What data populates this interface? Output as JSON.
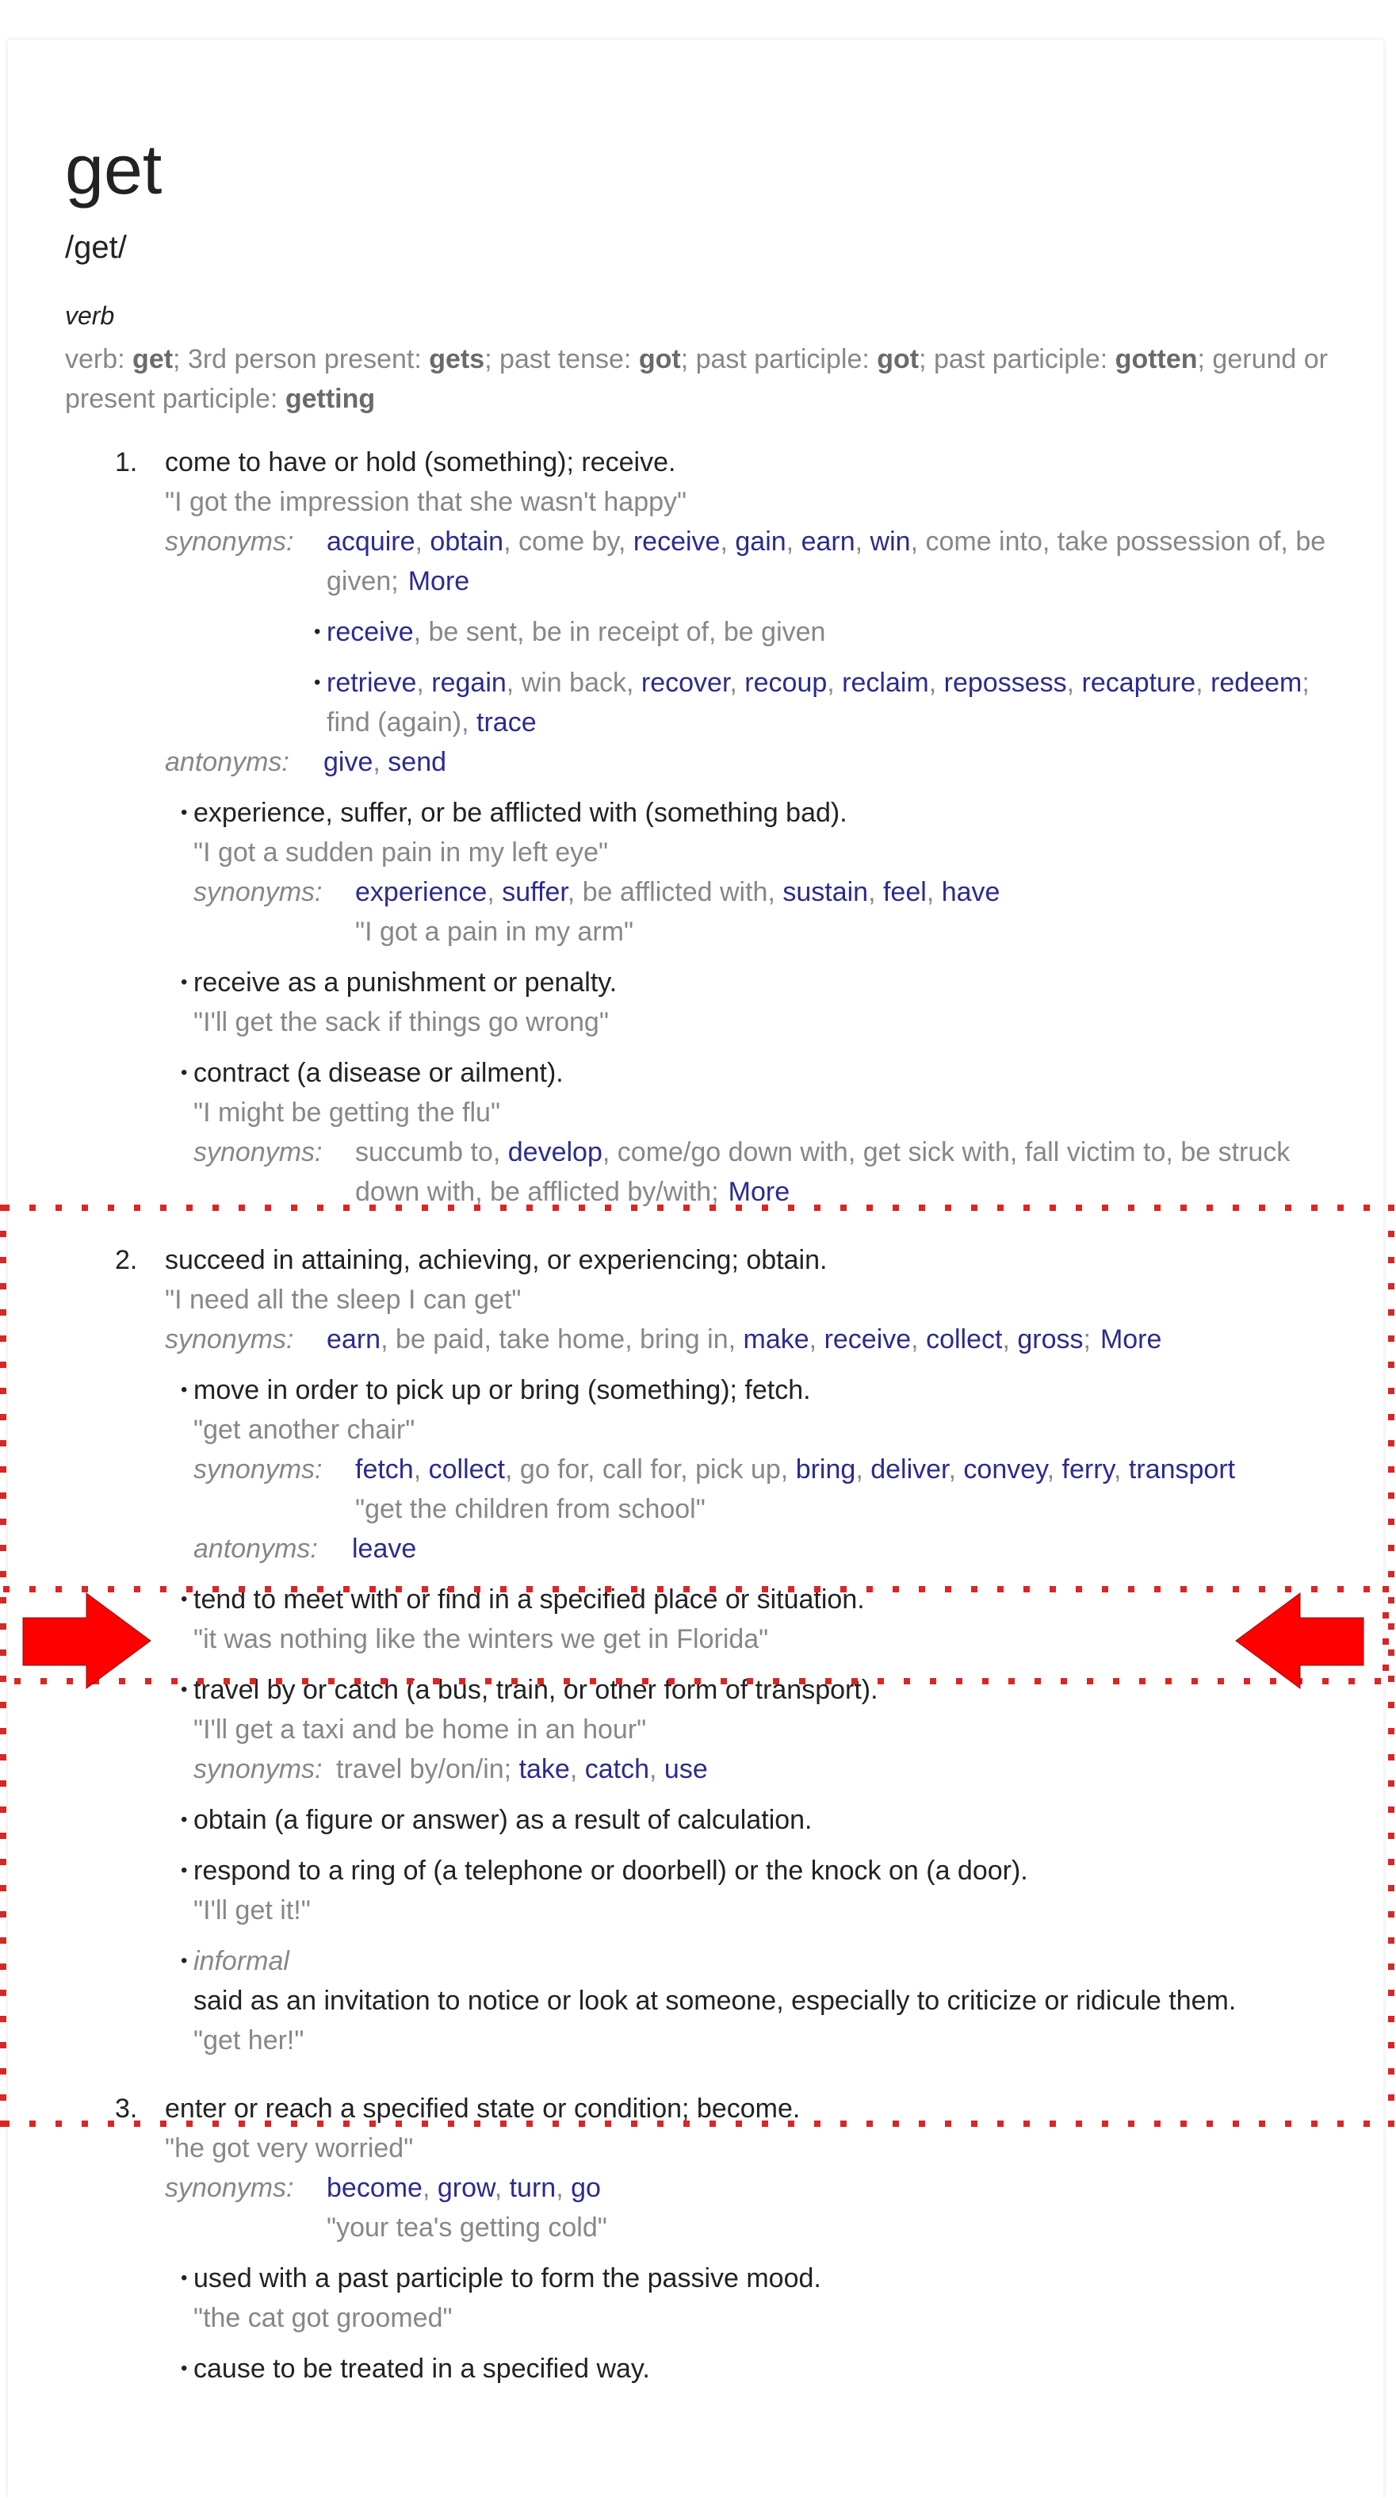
{
  "entry": {
    "headword": "get",
    "phonetic": "/get/",
    "part_of_speech": "verb",
    "forms": [
      {
        "label": "verb: ",
        "form": "get"
      },
      {
        "label": "; 3rd person present: ",
        "form": "gets"
      },
      {
        "label": "; past tense: ",
        "form": "got"
      },
      {
        "label": "; past participle: ",
        "form": "got"
      },
      {
        "label": "; past participle: ",
        "form": "gotten"
      },
      {
        "label": "; gerund or present participle: ",
        "form": "getting"
      }
    ]
  },
  "labels": {
    "synonyms": "synonyms:",
    "antonyms": "antonyms:",
    "more": "More"
  },
  "senses": {
    "s1": {
      "number": "1.",
      "gloss": "come to have or hold (something); receive.",
      "example": "\"I got the impression that she wasn't happy\"",
      "synonyms": [
        "acquire",
        "obtain",
        "come by",
        "receive",
        "gain",
        "earn",
        "win",
        "come into",
        "take possession of",
        "be given"
      ],
      "syn_groups": [
        [
          "receive",
          "be sent",
          "be in receipt of",
          "be given"
        ],
        [
          "retrieve",
          "regain",
          "win back",
          "recover",
          "recoup",
          "reclaim",
          "repossess",
          "recapture",
          "redeem"
        ]
      ],
      "syn_group2_extra": [
        "find (again)",
        "trace"
      ],
      "antonyms": [
        "give",
        "send"
      ],
      "subs": [
        {
          "gloss": "experience, suffer, or be afflicted with (something bad).",
          "example": "\"I got a sudden pain in my left eye\"",
          "synonyms": [
            "experience",
            "suffer",
            "be afflicted with",
            "sustain",
            "feel",
            "have"
          ],
          "syn_example": "\"I got a pain in my arm\""
        },
        {
          "gloss": "receive as a punishment or penalty.",
          "example": "\"I'll get the sack if things go wrong\""
        },
        {
          "gloss": "contract (a disease or ailment).",
          "example": "\"I might be getting the flu\"",
          "synonyms": [
            "succumb to",
            "develop",
            "come/go down with",
            "get sick with",
            "fall victim to",
            "be struck down with",
            "be afflicted by/with"
          ]
        }
      ]
    },
    "s2": {
      "number": "2.",
      "gloss": "succeed in attaining, achieving, or experiencing; obtain.",
      "example": "\"I need all the sleep I can get\"",
      "synonyms": [
        "earn",
        "be paid",
        "take home",
        "bring in",
        "make",
        "receive",
        "collect",
        "gross"
      ],
      "subs": [
        {
          "gloss": "move in order to pick up or bring (something); fetch.",
          "example": "\"get another chair\"",
          "synonyms": [
            "fetch",
            "collect",
            "go for",
            "call for",
            "pick up",
            "bring",
            "deliver",
            "convey",
            "ferry",
            "transport"
          ],
          "syn_example": "\"get the children from school\"",
          "antonyms": [
            "leave"
          ]
        },
        {
          "gloss": "tend to meet with or find in a specified place or situation.",
          "example": "\"it was nothing like the winters we get in Florida\"",
          "highlighted": true
        },
        {
          "gloss": "travel by or catch (a bus, train, or other form of transport).",
          "example": "\"I'll get a taxi and be home in an hour\"",
          "synonyms_prefix": "travel by/on/in; ",
          "synonyms": [
            "take",
            "catch",
            "use"
          ]
        },
        {
          "gloss": "obtain (a figure or answer) as a result of calculation."
        },
        {
          "gloss": "respond to a ring of (a telephone or doorbell) or the knock on (a door).",
          "example": "\"I'll get it!\""
        },
        {
          "register": "informal",
          "gloss": "said as an invitation to notice or look at someone, especially to criticize or ridicule them.",
          "example": "\"get her!\""
        }
      ]
    },
    "s3": {
      "number": "3.",
      "gloss": "enter or reach a specified state or condition; become.",
      "example": "\"he got very worried\"",
      "synonyms": [
        "become",
        "grow",
        "turn",
        "go"
      ],
      "syn_example": "\"your tea's getting cold\"",
      "subs": [
        {
          "gloss": "used with a past participle to form the passive mood.",
          "example": "\"the cat got groomed\""
        },
        {
          "gloss": "cause to be treated in a specified way."
        }
      ]
    }
  },
  "annotations": {
    "highlight_color": "#d92626",
    "arrow_color": "#ff0000"
  }
}
